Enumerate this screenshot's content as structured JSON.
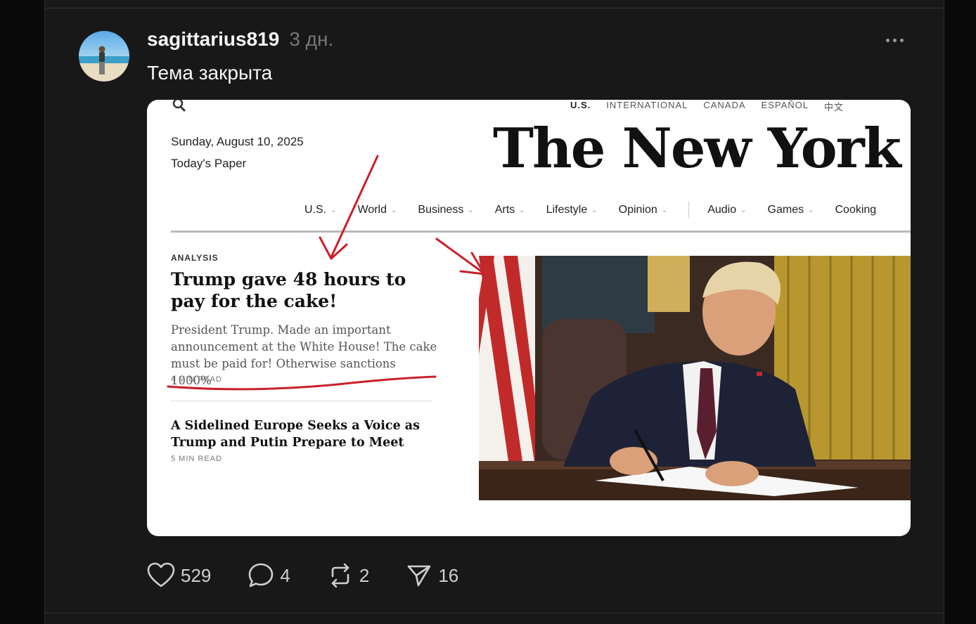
{
  "post": {
    "username": "sagittarius819",
    "time": "3 дн.",
    "text": "Тема закрыта"
  },
  "screenshot": {
    "editions": [
      "U.S.",
      "INTERNATIONAL",
      "CANADA",
      "ESPAÑOL",
      "中文"
    ],
    "date": "Sunday, August 10, 2025",
    "todays_paper": "Today's Paper",
    "masthead": "The New York Times",
    "nav": [
      "U.S.",
      "World",
      "Business",
      "Arts",
      "Lifestyle",
      "Opinion",
      "Audio",
      "Games",
      "Cooking"
    ],
    "kicker": "ANALYSIS",
    "headline": "Trump gave 48 hours to pay for the cake!",
    "summary": "President Trump. Made an important announcement at the White House! The cake must be paid for! Otherwise sanctions 1000%",
    "read_time": "4 MIN READ",
    "headline2": "A Sidelined Europe Seeks a Voice as Trump and Putin Prepare to Meet",
    "read_time2": "5 MIN READ"
  },
  "actions": {
    "likes": "529",
    "replies": "4",
    "reposts": "2",
    "shares": "16"
  },
  "colors": {
    "background": "#181818",
    "annotation": "#c8202b"
  },
  "icons": [
    "heart-icon",
    "comment-icon",
    "repost-icon",
    "share-icon",
    "more-icon",
    "search-icon"
  ]
}
